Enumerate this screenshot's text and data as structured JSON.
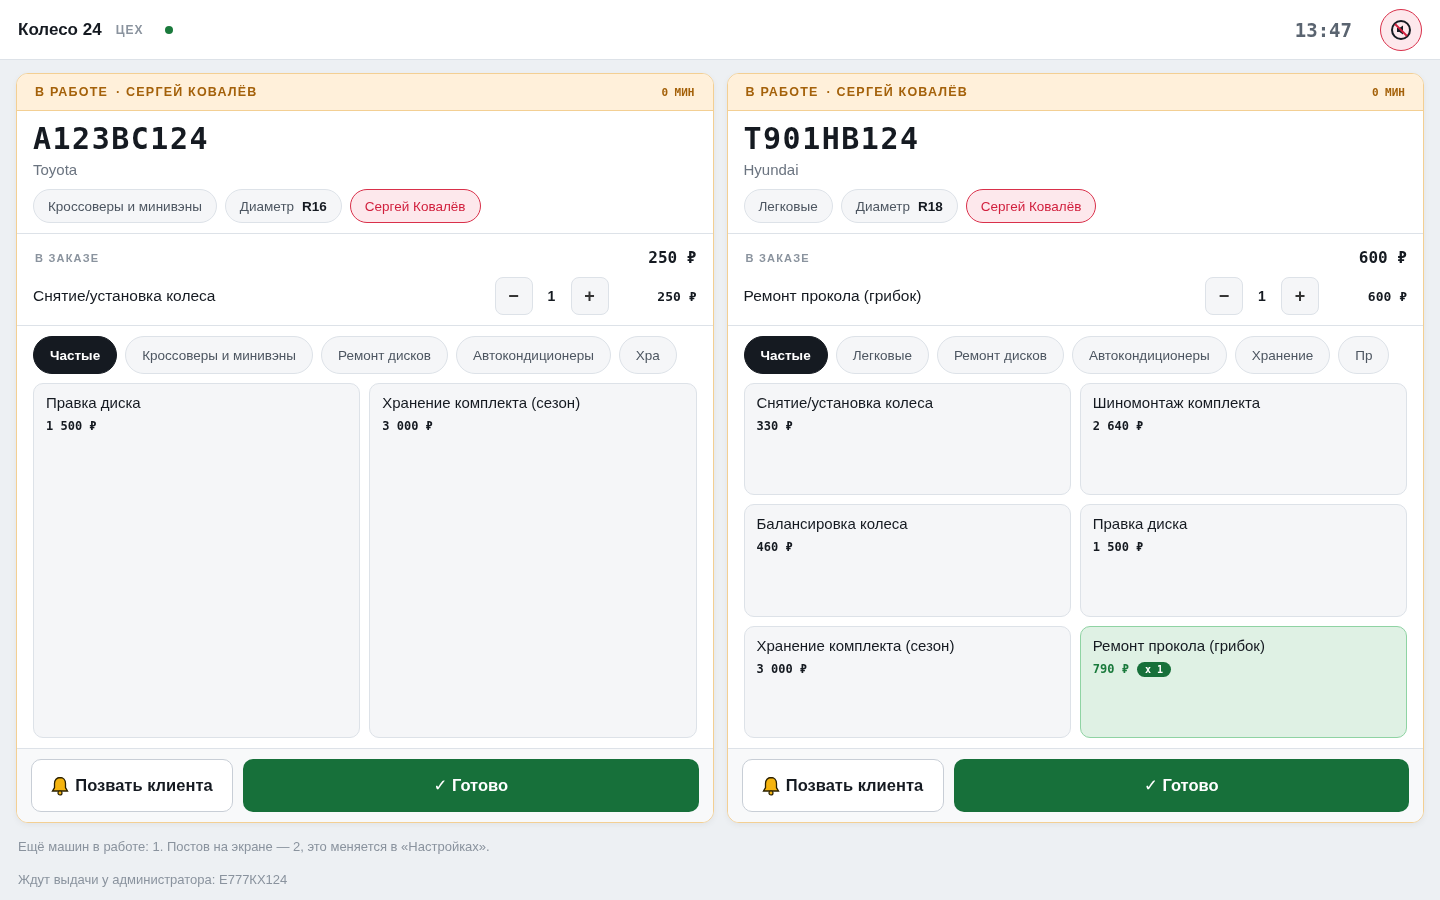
{
  "header": {
    "brand": "Колесо 24",
    "section": "ЦЕХ",
    "online": true,
    "clock": "13:47",
    "muted": true
  },
  "posts": [
    {
      "status": "В РАБОТЕ",
      "master": "· СЕРГЕЙ КОВАЛЁВ",
      "elapsed": "0 МИН",
      "plate": "А123ВС124",
      "make": "Toyota",
      "tags": [
        {
          "kind": "plain",
          "label": "Кроссоверы и минивэны"
        },
        {
          "kind": "param",
          "label": "Диаметр",
          "value": "R16"
        },
        {
          "kind": "person",
          "label": "Сергей Ковалёв"
        }
      ],
      "order": {
        "label": "В ЗАКАЗЕ",
        "total": "250 ₽",
        "lines": [
          {
            "name": "Снятие/установка колеса",
            "minus": "−",
            "qty": "1",
            "plus": "+",
            "sum": "250 ₽"
          }
        ]
      },
      "categories": [
        {
          "label": "Частые",
          "selected": true
        },
        {
          "label": "Кроссоверы и минивэны",
          "selected": false
        },
        {
          "label": "Ремонт дисков",
          "selected": false
        },
        {
          "label": "Автокондиционеры",
          "selected": false
        },
        {
          "label": "Хра",
          "selected": false
        }
      ],
      "services": [
        {
          "name": "Правка диска",
          "price": "1 500 ₽",
          "selected": false
        },
        {
          "name": "Хранение комплекта (сезон)",
          "price": "3 000 ₽",
          "selected": false
        }
      ],
      "call_button": "Позвать клиента",
      "done_button": "✓ Готово"
    },
    {
      "status": "В РАБОТЕ",
      "master": "· СЕРГЕЙ КОВАЛЁВ",
      "elapsed": "0 МИН",
      "plate": "Т901НВ124",
      "make": "Hyundai",
      "tags": [
        {
          "kind": "plain",
          "label": "Легковые"
        },
        {
          "kind": "param",
          "label": "Диаметр",
          "value": "R18"
        },
        {
          "kind": "person",
          "label": "Сергей Ковалёв"
        }
      ],
      "order": {
        "label": "В ЗАКАЗЕ",
        "total": "600 ₽",
        "lines": [
          {
            "name": "Ремонт прокола (грибок)",
            "minus": "−",
            "qty": "1",
            "plus": "+",
            "sum": "600 ₽"
          }
        ]
      },
      "categories": [
        {
          "label": "Частые",
          "selected": true
        },
        {
          "label": "Легковые",
          "selected": false
        },
        {
          "label": "Ремонт дисков",
          "selected": false
        },
        {
          "label": "Автокондиционеры",
          "selected": false
        },
        {
          "label": "Хранение",
          "selected": false
        },
        {
          "label": "Пр",
          "selected": false
        }
      ],
      "services": [
        {
          "name": "Снятие/установка колеса",
          "price": "330 ₽",
          "selected": false
        },
        {
          "name": "Шиномонтаж комплекта",
          "price": "2 640 ₽",
          "selected": false
        },
        {
          "name": "Балансировка колеса",
          "price": "460 ₽",
          "selected": false
        },
        {
          "name": "Правка диска",
          "price": "1 500 ₽",
          "selected": false
        },
        {
          "name": "Хранение комплекта (сезон)",
          "price": "3 000 ₽",
          "selected": false
        },
        {
          "name": "Ремонт прокола (грибок)",
          "price": "790 ₽",
          "selected": true,
          "badge": "x 1"
        }
      ],
      "call_button": "Позвать клиента",
      "done_button": "✓ Готово"
    }
  ],
  "notes": [
    "Ещё машин в работе: 1. Постов на экране — 2, это меняется в «Настройках».",
    "Ждут выдачи у администратора: Е777КХ124"
  ]
}
